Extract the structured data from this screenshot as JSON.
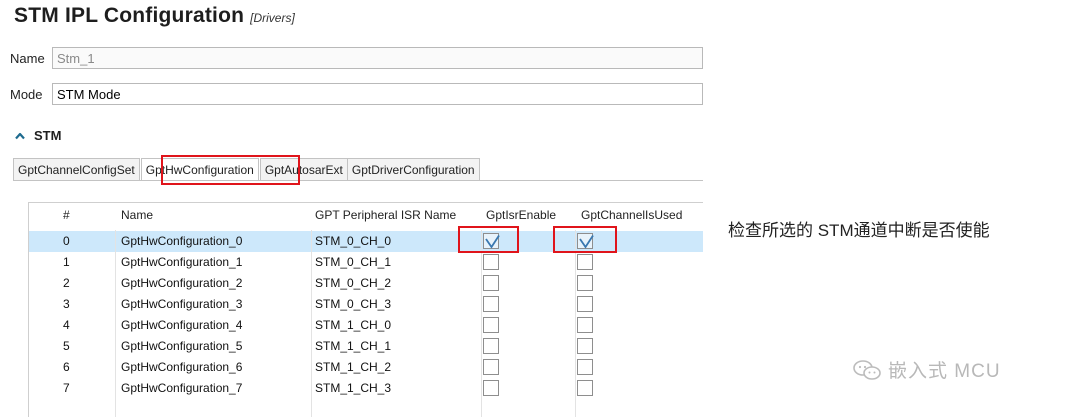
{
  "header": {
    "title": "STM IPL Configuration",
    "subtitle": "[Drivers]"
  },
  "fields": {
    "name_label": "Name",
    "name_value": "Stm_1",
    "mode_label": "Mode",
    "mode_value": "STM Mode"
  },
  "section": {
    "label": "STM",
    "icon": "chevron-up-icon"
  },
  "tabs": [
    {
      "label": "GptChannelConfigSet",
      "active": false
    },
    {
      "label": "GptHwConfiguration",
      "active": true
    },
    {
      "label": "GptAutosarExt",
      "active": false
    },
    {
      "label": "GptDriverConfiguration",
      "active": false
    }
  ],
  "table": {
    "columns": [
      "#",
      "Name",
      "GPT Peripheral ISR Name",
      "GptIsrEnable",
      "GptChannelIsUsed"
    ],
    "rows": [
      {
        "idx": "0",
        "name": "GptHwConfiguration_0",
        "isr": "STM_0_CH_0",
        "isr_enable": true,
        "used": true,
        "selected": true
      },
      {
        "idx": "1",
        "name": "GptHwConfiguration_1",
        "isr": "STM_0_CH_1",
        "isr_enable": false,
        "used": false,
        "selected": false
      },
      {
        "idx": "2",
        "name": "GptHwConfiguration_2",
        "isr": "STM_0_CH_2",
        "isr_enable": false,
        "used": false,
        "selected": false
      },
      {
        "idx": "3",
        "name": "GptHwConfiguration_3",
        "isr": "STM_0_CH_3",
        "isr_enable": false,
        "used": false,
        "selected": false
      },
      {
        "idx": "4",
        "name": "GptHwConfiguration_4",
        "isr": "STM_1_CH_0",
        "isr_enable": false,
        "used": false,
        "selected": false
      },
      {
        "idx": "5",
        "name": "GptHwConfiguration_5",
        "isr": "STM_1_CH_1",
        "isr_enable": false,
        "used": false,
        "selected": false
      },
      {
        "idx": "6",
        "name": "GptHwConfiguration_6",
        "isr": "STM_1_CH_2",
        "isr_enable": false,
        "used": false,
        "selected": false
      },
      {
        "idx": "7",
        "name": "GptHwConfiguration_7",
        "isr": "STM_1_CH_3",
        "isr_enable": false,
        "used": false,
        "selected": false
      }
    ]
  },
  "annotation": "检查所选的 STM通道中断是否使能",
  "watermark": {
    "text": "嵌入式 MCU",
    "icon": "wechat-icon"
  },
  "colors": {
    "highlight": "#e0141b",
    "selected_row": "#cde8fb",
    "check": "#3a78b0"
  }
}
